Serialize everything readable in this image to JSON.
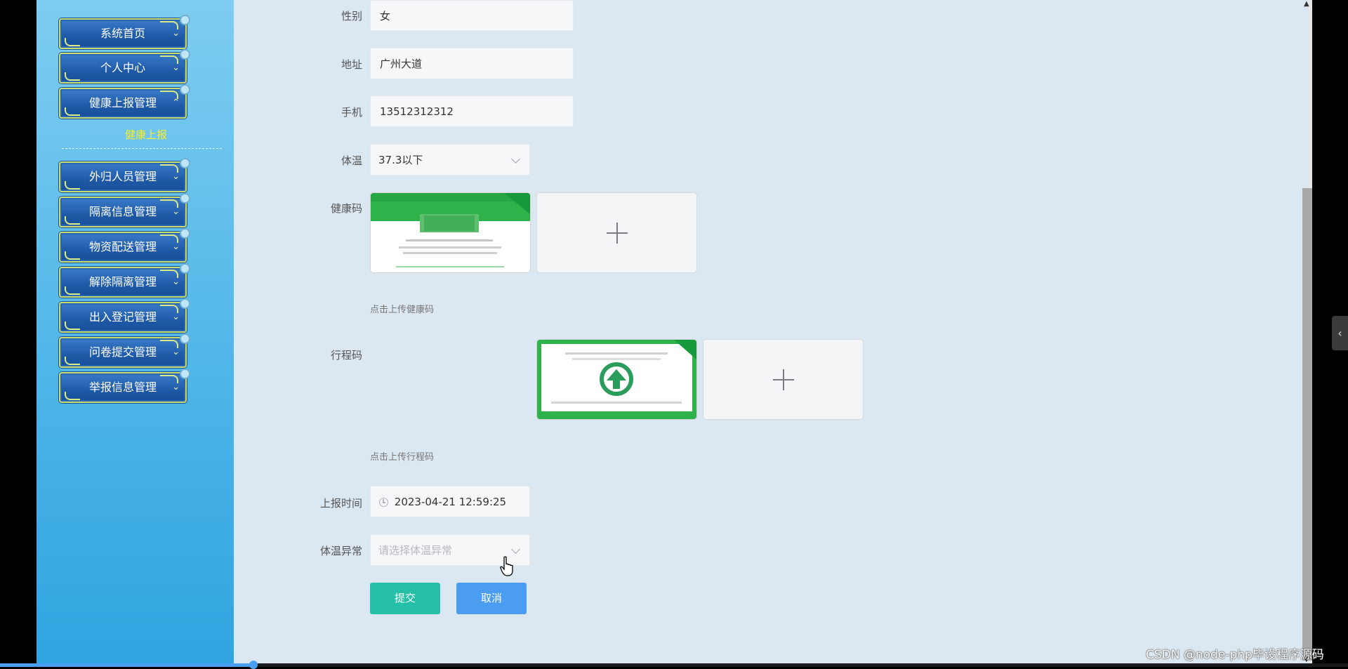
{
  "sidebar": {
    "items": [
      {
        "label": "系统首页"
      },
      {
        "label": "个人中心"
      },
      {
        "label": "健康上报管理"
      },
      {
        "label": "外归人员管理"
      },
      {
        "label": "隔离信息管理"
      },
      {
        "label": "物资配送管理"
      },
      {
        "label": "解除隔离管理"
      },
      {
        "label": "出入登记管理"
      },
      {
        "label": "问卷提交管理"
      },
      {
        "label": "举报信息管理"
      }
    ],
    "sub_item": "健康上报"
  },
  "form": {
    "gender_label": "性别",
    "gender_value": "女",
    "address_label": "地址",
    "address_value": "广州大道",
    "phone_label": "手机",
    "phone_value": "13512312312",
    "temp_label": "体温",
    "temp_value": "37.3以下",
    "health_code_label": "健康码",
    "health_code_hint": "点击上传健康码",
    "trip_code_label": "行程码",
    "trip_code_hint": "点击上传行程码",
    "report_time_label": "上报时间",
    "report_time_value": "2023-04-21 12:59:25",
    "temp_abnormal_label": "体温异常",
    "temp_abnormal_placeholder": "请选择体温异常",
    "submit_label": "提交",
    "cancel_label": "取消"
  },
  "watermark": "CSDN @node-php毕设程序源码",
  "colors": {
    "submit": "#26bfa8",
    "cancel": "#4a9df0",
    "sub_item": "#f7ef2b",
    "main_bg": "#dce8f1"
  }
}
